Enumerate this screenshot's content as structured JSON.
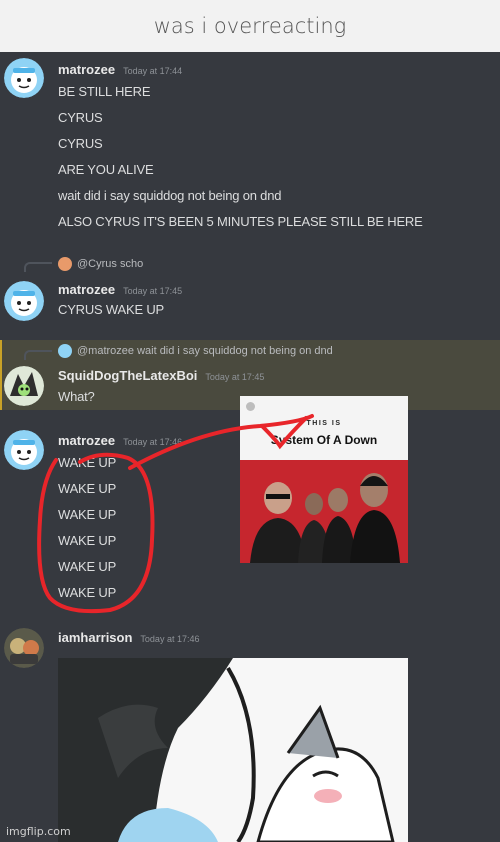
{
  "header": {
    "title": "was i overreacting"
  },
  "messages": [
    {
      "author": "matrozee",
      "timestamp": "Today at 17:44",
      "lines": [
        "BE STILL HERE",
        "CYRUS",
        "CYRUS",
        "ARE YOU ALIVE",
        "wait did i say squiddog not being on dnd",
        "ALSO CYRUS IT'S BEEN 5 MINUTES PLEASE STILL BE HERE"
      ]
    },
    {
      "reply_to": "@Cyrus scho",
      "author": "matrozee",
      "timestamp": "Today at 17:45",
      "lines": [
        "CYRUS WAKE UP"
      ]
    },
    {
      "reply_to": "@matrozee wait did i say squiddog not being on dnd",
      "author": "SquidDogTheLatexBoi",
      "timestamp": "Today at 17:45",
      "lines": [
        "What?"
      ]
    },
    {
      "author": "matrozee",
      "timestamp": "Today at 17:46",
      "lines": [
        "WAKE UP",
        "WAKE UP",
        "WAKE UP",
        "WAKE UP",
        "WAKE UP",
        "WAKE UP"
      ]
    },
    {
      "author": "iamharrison",
      "timestamp": "Today at 17:46",
      "lines": []
    }
  ],
  "album": {
    "kicker": "THIS IS",
    "artist": "System Of A Down"
  },
  "watermark": "imgflip.com",
  "colors": {
    "background": "#36393f",
    "annotation": "#e8252a",
    "highlight": "#4a4a3e"
  }
}
